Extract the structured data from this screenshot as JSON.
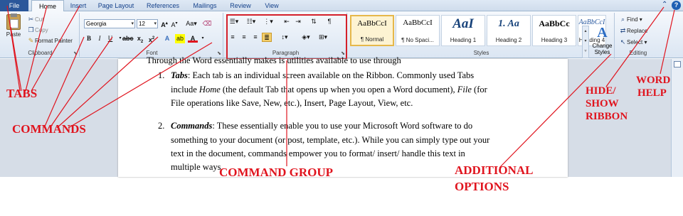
{
  "tabs": [
    "File",
    "Home",
    "Insert",
    "Page Layout",
    "References",
    "Mailings",
    "Review",
    "View"
  ],
  "ribbon": {
    "clipboard": {
      "paste_label": "Paste",
      "cut_label": "Cut",
      "copy_label": "Copy",
      "format_painter_label": "Format Painter",
      "group_label": "Clipboard"
    },
    "font": {
      "font_name": "Georgia",
      "font_size": "12",
      "group_label": "Font"
    },
    "paragraph": {
      "group_label": "Paragraph"
    },
    "styles": {
      "group_label": "Styles",
      "change_styles_label": "Change Styles",
      "tiles": [
        {
          "sample": "AaBbCcI",
          "name": "¶ Normal"
        },
        {
          "sample": "AaBbCcI",
          "name": "¶ No Spaci..."
        },
        {
          "sample": "AaI",
          "name": "Heading 1"
        },
        {
          "sample": "1. Aa",
          "name": "Heading 2"
        },
        {
          "sample": "AaBbCc",
          "name": "Heading 3"
        },
        {
          "sample": "AaBbCcI",
          "name": "Heading 4"
        }
      ]
    },
    "editing": {
      "find_label": "Find",
      "replace_label": "Replace",
      "select_label": "Select",
      "group_label": "Editing"
    }
  },
  "document": {
    "lines": [
      "Through the Word essentially makes is utilities available to use through",
      "Tabs: Each tab is an individual screen available on the Ribbon. Commonly used Tabs",
      "include Home (the default Tab that opens up when you open a Word document), File (for",
      "File operations like Save, New, etc.), Insert, Page Layout, View, etc.",
      "Commands: These essentially enable you to use your Microsoft Word software to do",
      "something to your document (or post, template, etc.). While you can simply type out your",
      "text in the document, commands empower you to format/ insert/ handle this text in",
      "multiple ways."
    ],
    "item1_number": "1.",
    "item2_number": "2."
  },
  "annotations": {
    "tabs": "TABS",
    "commands": "COMMANDS",
    "command_group": "COMMAND GROUP",
    "additional_line1": "ADDITIONAL",
    "additional_line2": "OPTIONS",
    "hide_line1": "HIDE/",
    "hide_line2": "SHOW",
    "hide_line3": "RIBBON",
    "word_help_line1": "WORD",
    "word_help_line2": "HELP"
  },
  "colors": {
    "annotation": "#e0141e",
    "ribbon_bg": "#dbe6f3",
    "file_tab": "#2b579a"
  }
}
